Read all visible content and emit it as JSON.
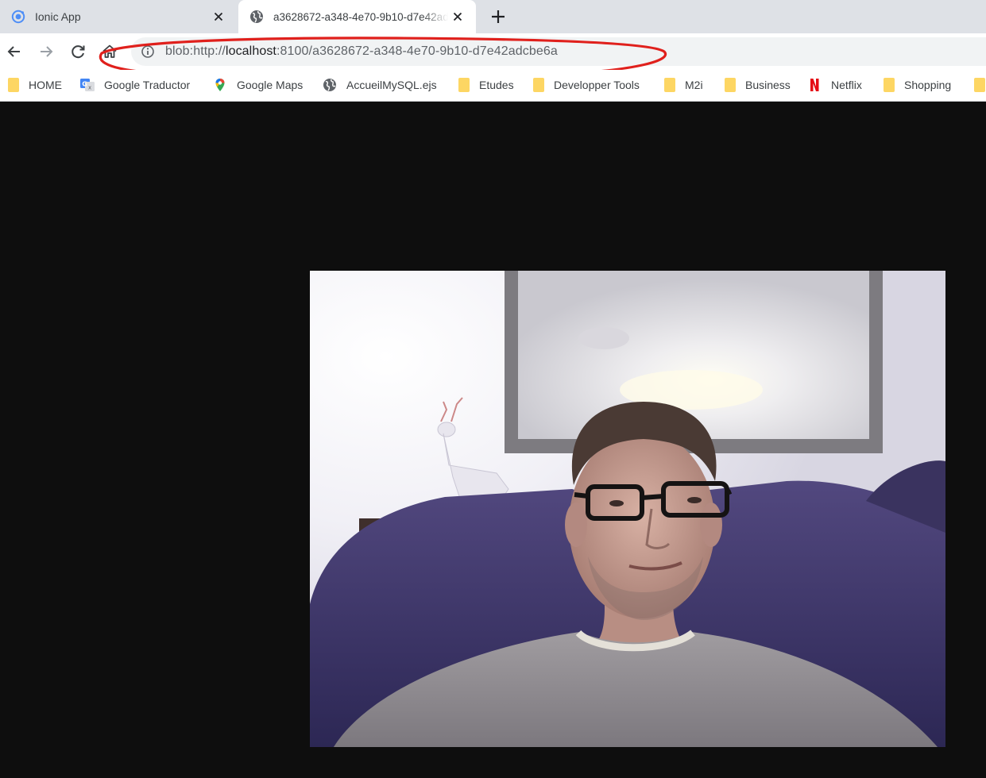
{
  "tabs": [
    {
      "title": "Ionic App",
      "icon": "ionic-icon",
      "active": false
    },
    {
      "title": "a3628672-a348-4e70-9b10-d7e42adcbe6a",
      "icon": "globe-icon",
      "active": true
    }
  ],
  "toolbar": {
    "back_icon": "arrow-left-icon",
    "forward_icon": "arrow-right-icon",
    "reload_icon": "reload-icon",
    "home_icon": "home-icon"
  },
  "address": {
    "scheme": "blob:http://",
    "host": "localhost",
    "rest": ":8100/a3628672-a348-4e70-9b10-d7e42adcbe6a",
    "annotation_color": "#e0201c"
  },
  "bookmarks": [
    {
      "label": "HOME",
      "icon": "folder-icon"
    },
    {
      "label": "Google Traductor",
      "icon": "google-translate-icon"
    },
    {
      "label": "Google Maps",
      "icon": "google-maps-icon"
    },
    {
      "label": "AccueilMySQL.ejs",
      "icon": "globe-icon"
    },
    {
      "label": "Etudes",
      "icon": "folder-icon"
    },
    {
      "label": "Developper Tools",
      "icon": "folder-icon"
    },
    {
      "label": "M2i",
      "icon": "folder-icon"
    },
    {
      "label": "Business",
      "icon": "folder-icon"
    },
    {
      "label": "Netflix",
      "icon": "netflix-icon"
    },
    {
      "label": "Shopping",
      "icon": "folder-icon"
    }
  ],
  "content": {
    "background": "#0e0e0e",
    "media": "webcam-video-frame"
  },
  "colors": {
    "tabstrip": "#dee1e6",
    "omnibox": "#f1f3f4",
    "folder": "#fdd663"
  }
}
